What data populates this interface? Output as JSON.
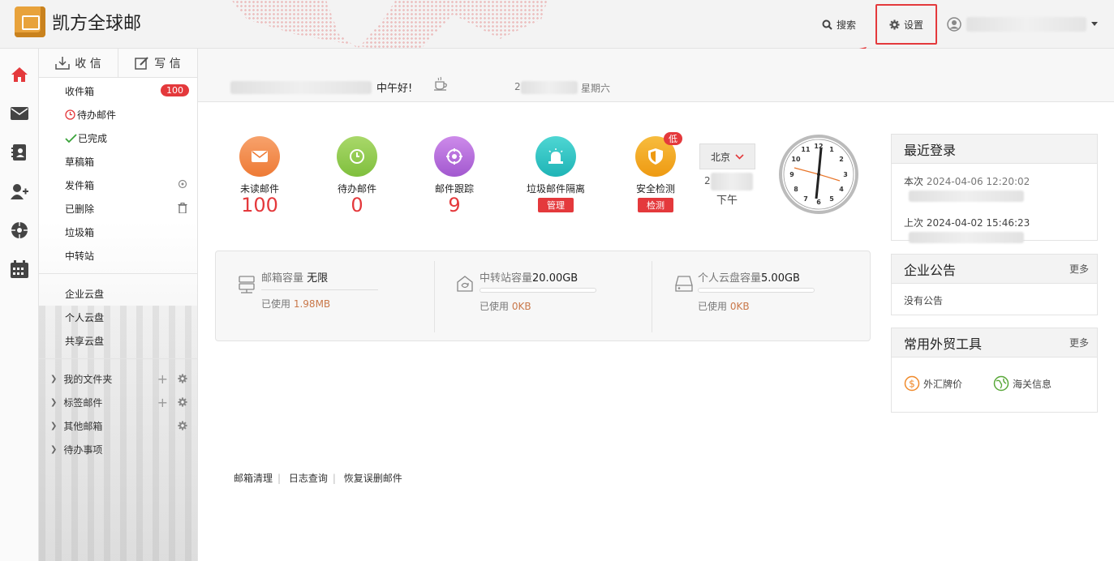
{
  "header": {
    "logo_text": "凯方全球邮",
    "search_label": "搜索",
    "settings_label": "设置"
  },
  "compose": {
    "receive_label": "收 信",
    "write_label": "写 信"
  },
  "folders": [
    {
      "label": "收件箱",
      "badge": "100"
    },
    {
      "label": "待办邮件"
    },
    {
      "label": "已完成"
    },
    {
      "label": "草稿箱"
    },
    {
      "label": "发件箱"
    },
    {
      "label": "已删除"
    },
    {
      "label": "垃圾箱"
    },
    {
      "label": "中转站"
    }
  ],
  "cloud": [
    "企业云盘",
    "个人云盘",
    "共享云盘"
  ],
  "tree": [
    "我的文件夹",
    "标签邮件",
    "其他邮箱",
    "待办事项"
  ],
  "greeting": {
    "text": "中午好!",
    "date_prefix": "2",
    "weekday": "星期六"
  },
  "stats": [
    {
      "label": "未读邮件",
      "value": "100",
      "color": "#f08a4b"
    },
    {
      "label": "待办邮件",
      "value": "0",
      "color": "#8dc63f"
    },
    {
      "label": "邮件跟踪",
      "value": "9",
      "color": "#b366d6"
    },
    {
      "label": "垃圾邮件隔离",
      "button": "管理",
      "color": "#2ec4c4"
    },
    {
      "label": "安全检测",
      "button": "检测",
      "badge": "低",
      "color": "#f2a51c"
    }
  ],
  "clock": {
    "city": "北京",
    "date_prefix": "2",
    "period": "下午"
  },
  "storage": {
    "mailbox": {
      "title": "邮箱容量",
      "value": "无限",
      "used_label": "已使用",
      "used": "1.98MB"
    },
    "transfer": {
      "title": "中转站容量",
      "value": "20.00GB",
      "used_label": "已使用",
      "used": "0KB"
    },
    "personal": {
      "title": "个人云盘容量",
      "value": "5.00GB",
      "used_label": "已使用",
      "used": "0KB"
    }
  },
  "footer_links": [
    "邮箱清理",
    "日志查询",
    "恢复误删邮件"
  ],
  "recent_login": {
    "title": "最近登录",
    "current_label": "本次",
    "current_time": "2024-04-06 12:20:02",
    "last_label": "上次",
    "last_time": "2024-04-02 15:46:23"
  },
  "announcement": {
    "title": "企业公告",
    "more": "更多",
    "body": "没有公告"
  },
  "tools": {
    "title": "常用外贸工具",
    "more": "更多",
    "items": [
      "外汇牌价",
      "海关信息"
    ]
  },
  "colors": {
    "accent_red": "#e4393c",
    "brand_orange": "#e8a23b"
  }
}
